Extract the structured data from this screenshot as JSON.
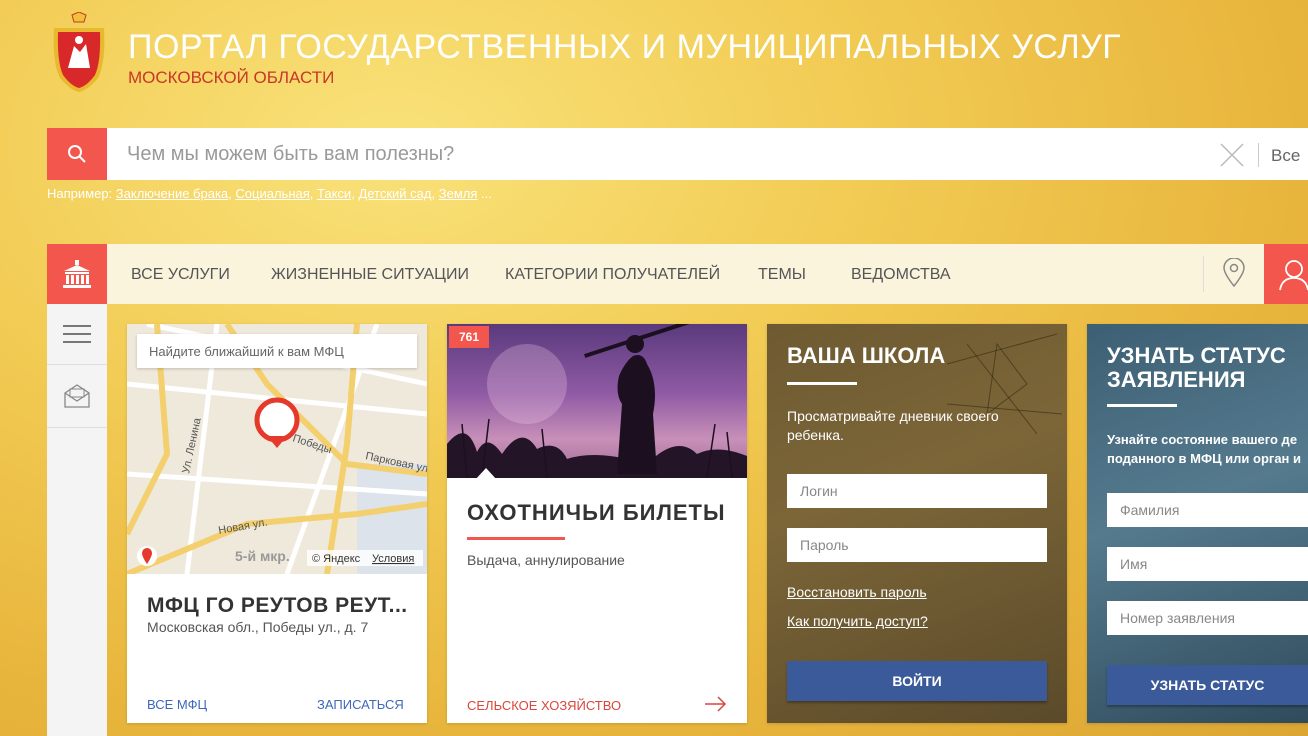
{
  "header": {
    "title": "ПОРТАЛ ГОСУДАРСТВЕННЫХ И МУНИЦИПАЛЬНЫХ УСЛУГ",
    "subtitle": "МОСКОВСКОЙ ОБЛАСТИ"
  },
  "search": {
    "placeholder": "Чем мы можем быть вам полезны?",
    "value": "",
    "scope": "Все",
    "examples_label": "Например:",
    "examples": [
      "Заключение брака",
      "Социальная",
      "Такси",
      "Детский сад",
      "Земля"
    ],
    "examples_more": "..."
  },
  "nav": {
    "items": [
      "ВСЕ УСЛУГИ",
      "ЖИЗНЕННЫЕ СИТУАЦИИ",
      "КАТЕГОРИИ ПОЛУЧАТЕЛЕЙ",
      "ТЕМЫ",
      "ВЕДОМСТВА"
    ]
  },
  "mfc_card": {
    "map_search_placeholder": "Найдите ближайший к вам МФЦ",
    "map_labels": {
      "street1": "Ул. Ленина",
      "street2": "Победы",
      "street3": "Парковая ул.",
      "street4": "Новая ул.",
      "district": "5-й мкр.",
      "copyright": "© Яндекс",
      "terms": "Условия"
    },
    "name": "МФЦ ГО РЕУТОВ РЕУТ...",
    "address": "Московская обл., Победы ул., д. 7",
    "link_all": "ВСЕ МФЦ",
    "link_signup": "ЗАПИСАТЬСЯ"
  },
  "hunting_card": {
    "badge": "761",
    "title": "ОХОТНИЧЬИ БИЛЕТЫ",
    "description": "Выдача, аннулирование",
    "category": "СЕЛЬСКОЕ ХОЗЯЙСТВО"
  },
  "school_card": {
    "title": "ВАША ШКОЛА",
    "description": "Просматривайте дневник своего ребенка.",
    "login_placeholder": "Логин",
    "password_placeholder": "Пароль",
    "restore_link": "Восстановить пароль",
    "access_link": "Как получить доступ?",
    "submit": "ВОЙТИ"
  },
  "status_card": {
    "title": "УЗНАТЬ СТАТУС ЗАЯВЛЕНИЯ",
    "description": "Узнайте состояние вашего де поданного в МФЦ или орган и",
    "lastname_placeholder": "Фамилия",
    "firstname_placeholder": "Имя",
    "number_placeholder": "Номер заявления",
    "submit": "УЗНАТЬ СТАТУС"
  },
  "colors": {
    "accent": "#f2564c",
    "link_blue": "#3f68b8",
    "button_blue": "#3b5a9a",
    "nav_bg": "#fbf4dd"
  },
  "icons": {
    "logo": "moscow-oblast-emblem",
    "search": "search-icon",
    "clear": "close-icon",
    "home": "government-building-icon",
    "location": "location-pin-icon",
    "user": "user-icon",
    "menu": "hamburger-menu-icon",
    "mail": "envelope-icon",
    "map_marker": "map-marker-icon",
    "arrow": "arrow-right-icon"
  }
}
